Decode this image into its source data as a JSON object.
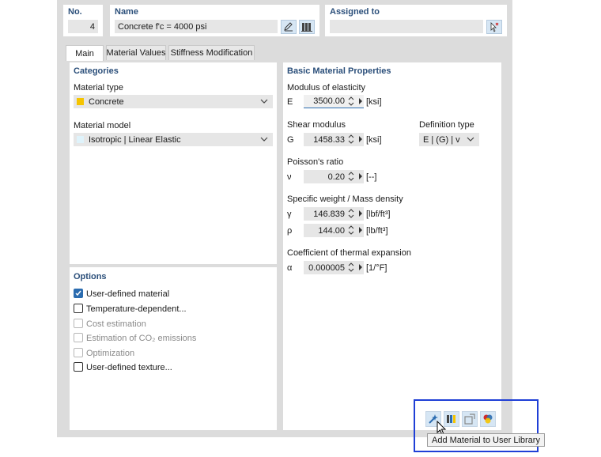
{
  "header": {
    "no_label": "No.",
    "no_value": "4",
    "name_label": "Name",
    "name_value": "Concrete f'c = 4000 psi",
    "assigned_label": "Assigned to",
    "assigned_value": ""
  },
  "tabs": [
    {
      "label": "Main",
      "active": true
    },
    {
      "label": "Material Values",
      "active": false
    },
    {
      "label": "Stiffness Modification",
      "active": false
    }
  ],
  "categories": {
    "title": "Categories",
    "material_type_label": "Material type",
    "material_type_value": "Concrete",
    "material_type_color": "#f5c400",
    "material_model_label": "Material model",
    "material_model_value": "Isotropic | Linear Elastic",
    "material_model_color": "#dff3fb"
  },
  "options": {
    "title": "Options",
    "items": [
      {
        "label": "User-defined material",
        "checked": true,
        "disabled": false
      },
      {
        "label": "Temperature-dependent...",
        "checked": false,
        "disabled": false
      },
      {
        "label": "Cost estimation",
        "checked": false,
        "disabled": true
      },
      {
        "label": "Estimation of CO₂ emissions",
        "checked": false,
        "disabled": true
      },
      {
        "label": "Optimization",
        "checked": false,
        "disabled": true
      },
      {
        "label": "User-defined texture...",
        "checked": false,
        "disabled": false
      }
    ]
  },
  "basic": {
    "title": "Basic Material Properties",
    "modulus_label": "Modulus of elasticity",
    "E_symbol": "E",
    "E_value": "3500.00",
    "E_unit": "[ksi]",
    "shear_label": "Shear modulus",
    "G_symbol": "G",
    "G_value": "1458.33",
    "G_unit": "[ksi]",
    "deftype_label": "Definition type",
    "deftype_value": "E | (G) | v",
    "poisson_label": "Poisson's ratio",
    "nu_symbol": "ν",
    "nu_value": "0.20",
    "nu_unit": "[--]",
    "weight_label": "Specific weight / Mass density",
    "gamma_symbol": "γ",
    "gamma_value": "146.839",
    "gamma_unit": "[lbf/ft³]",
    "rho_symbol": "ρ",
    "rho_value": "144.00",
    "rho_unit": "[lb/ft³]",
    "thermal_label": "Coefficient of thermal expansion",
    "alpha_symbol": "α",
    "alpha_value": "0.000005",
    "alpha_unit": "[1/°F]"
  },
  "toolbar": {
    "tooltip": "Add Material to User Library",
    "buttons": [
      "add-to-user-library-icon",
      "library-icon",
      "export-icon",
      "color-palette-icon"
    ]
  }
}
